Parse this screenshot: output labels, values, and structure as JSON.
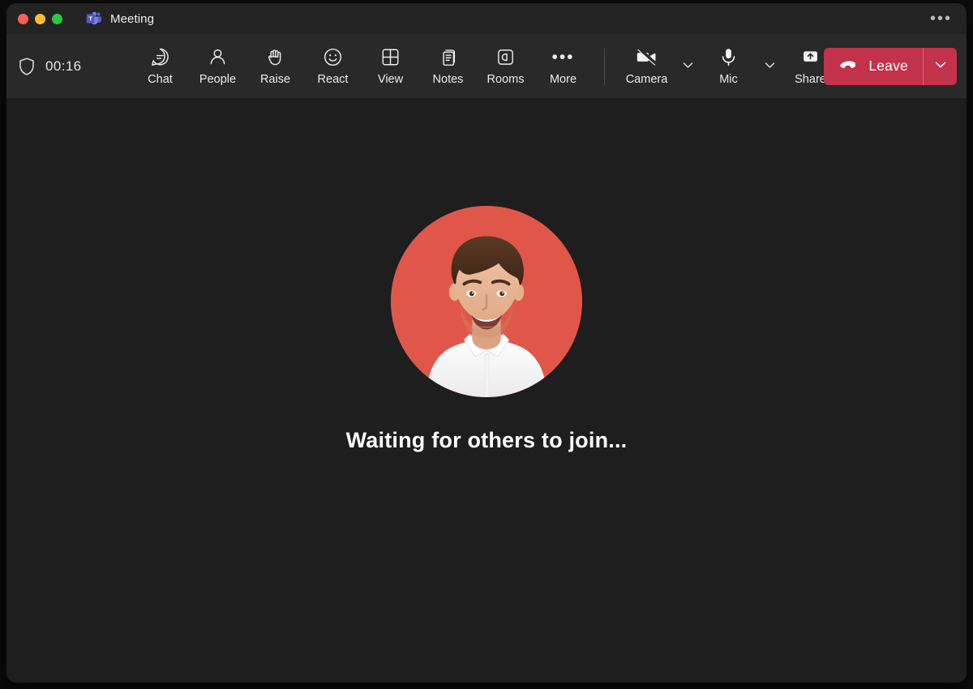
{
  "window": {
    "title": "Meeting",
    "app_icon": "teams-logo-icon",
    "traffic_lights": [
      "close",
      "minimize",
      "zoom"
    ],
    "more_menu_label": "•••"
  },
  "toolbar": {
    "shield_icon": "shield-icon",
    "timer": "00:16",
    "actions": [
      {
        "label": "Chat",
        "icon": "chat-icon"
      },
      {
        "label": "People",
        "icon": "people-icon"
      },
      {
        "label": "Raise",
        "icon": "raise-hand-icon"
      },
      {
        "label": "React",
        "icon": "react-smiley-icon"
      },
      {
        "label": "View",
        "icon": "view-grid-icon"
      },
      {
        "label": "Notes",
        "icon": "notes-icon"
      },
      {
        "label": "Rooms",
        "icon": "breakout-rooms-icon"
      },
      {
        "label": "More",
        "icon": "more-dots-icon"
      }
    ],
    "devices": [
      {
        "label": "Camera",
        "icon": "camera-off-icon",
        "state": "off",
        "dropdown_icon": "chevron-down-icon"
      },
      {
        "label": "Mic",
        "icon": "mic-on-icon",
        "state": "on",
        "dropdown_icon": "chevron-down-icon"
      }
    ],
    "share": {
      "label": "Share",
      "icon": "share-screen-icon"
    },
    "leave": {
      "label": "Leave",
      "icon": "hang-up-icon",
      "dropdown_icon": "chevron-down-icon",
      "color": "#c4314b"
    }
  },
  "stage": {
    "avatar": {
      "icon": "participant-avatar",
      "alt": "Smiling man in a white shirt on a coral background",
      "background_color": "#e2594c"
    },
    "status_message": "Waiting for others to join..."
  },
  "colors": {
    "window_background": "#1e1e1e",
    "titlebar": "#232323",
    "toolbar": "#292929",
    "accent_red": "#c4314b",
    "text_primary": "#ffffff",
    "avatar_coral": "#e2594c"
  }
}
